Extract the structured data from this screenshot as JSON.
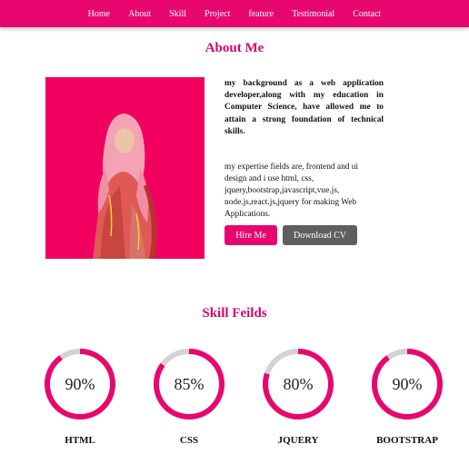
{
  "nav": {
    "items": [
      "Home",
      "About",
      "Skill",
      "Project",
      "feature",
      "Testimonial",
      "Contact"
    ]
  },
  "about": {
    "title": "About Me",
    "background_text": "my background as a web application developer,along with my education in Computer Science, have allowed me to attain a strong foundation of technical skills.",
    "expertise_text": "my expertise fields are, frontend and ui design and i use html, css, jquery,bootstrap,javascript,vue.js, node.js,react.js,jquery for making Web Applications.",
    "hire_label": "Hire Me",
    "cv_label": "Download CV"
  },
  "skills": {
    "title": "Skill Feilds",
    "items": [
      {
        "name": "HTML",
        "percent_label": "90%",
        "percent": 90
      },
      {
        "name": "CSS",
        "percent_label": "85%",
        "percent": 85
      },
      {
        "name": "JQUERY",
        "percent_label": "80%",
        "percent": 80
      },
      {
        "name": "BOOTSTRAP",
        "percent_label": "90%",
        "percent": 90
      }
    ]
  },
  "colors": {
    "accent": "#e8076e",
    "ring_track": "#d3d3d3",
    "photo_bg": "#f2005f",
    "cv_button": "#5f5f5f"
  }
}
